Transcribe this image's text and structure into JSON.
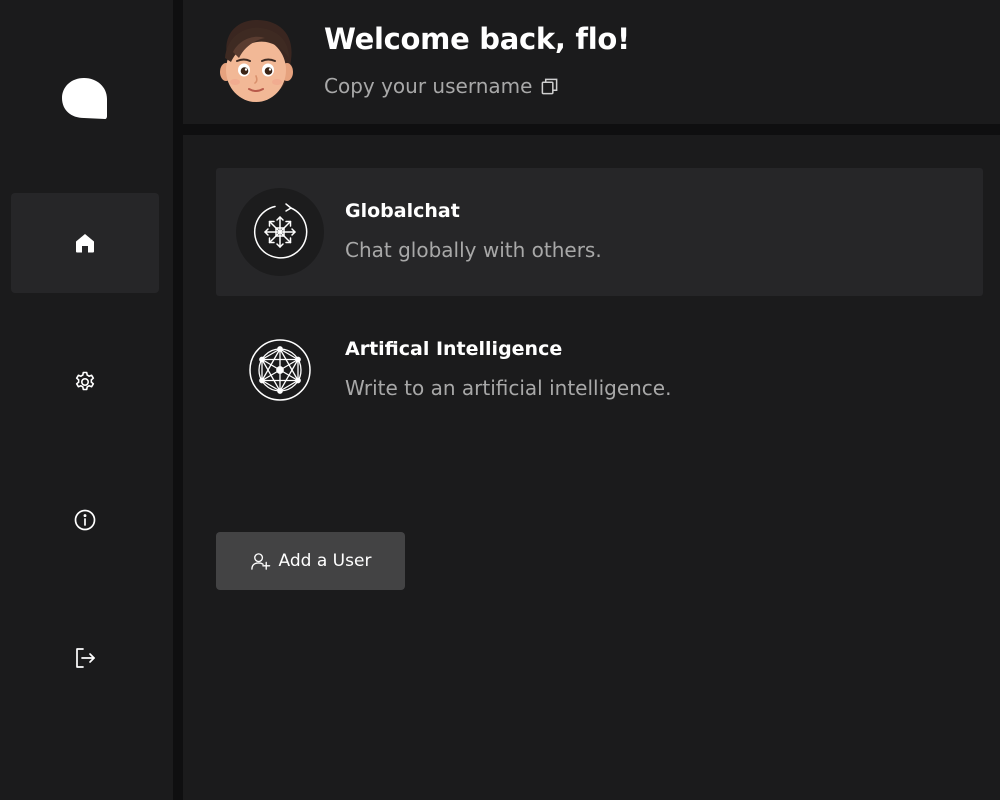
{
  "header": {
    "welcome": "Welcome back, flo!",
    "copy_username_label": "Copy your username"
  },
  "sidebar": {
    "items": [
      {
        "name": "home",
        "icon": "home-icon",
        "active": true
      },
      {
        "name": "settings",
        "icon": "gear-icon",
        "active": false
      },
      {
        "name": "info",
        "icon": "info-icon",
        "active": false
      },
      {
        "name": "logout",
        "icon": "logout-icon",
        "active": false
      }
    ]
  },
  "chats": [
    {
      "title": "Globalchat",
      "subtitle": "Chat globally with others.",
      "icon": "globe-arrows-icon",
      "active": true
    },
    {
      "title": "Artifical Intelligence",
      "subtitle": "Write to an artificial intelligence.",
      "icon": "ai-network-icon",
      "active": false
    }
  ],
  "actions": {
    "add_user_label": "Add a User"
  },
  "colors": {
    "background": "#1b1b1c",
    "divider": "#0f0f10",
    "active_item": "#262628",
    "button": "#434344",
    "muted_text": "#a8a8a8"
  }
}
